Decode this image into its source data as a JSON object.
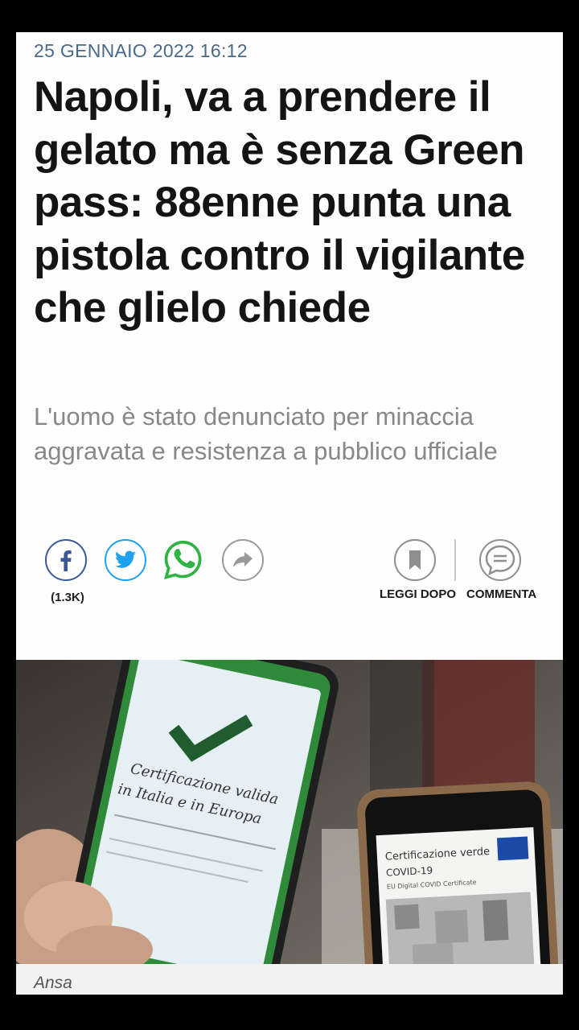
{
  "article": {
    "date": "25 GENNAIO 2022 16:12",
    "title": "Napoli, va a prendere il gelato ma è senza Green pass: 88enne punta una pistola contro il vigilante che glielo chiede",
    "subtitle": "L'uomo è stato denunciato per minaccia aggravata e resistenza a pubblico ufficiale"
  },
  "share": {
    "facebook_count": "(1.3K)",
    "icons": [
      "facebook-icon",
      "twitter-icon",
      "whatsapp-icon",
      "share-arrow-icon"
    ]
  },
  "actions": {
    "read_later_label": "LEGGI DOPO",
    "comment_label": "COMMENTA"
  },
  "photo": {
    "credit": "Ansa",
    "phone1_text_line1": "Certificazione valida",
    "phone1_text_line2": "in Italia e in Europa",
    "phone2_title_line1": "Certificazione verde",
    "phone2_title_line2": "COVID-19",
    "phone2_subtitle": "EU Digital COVID Certificate"
  },
  "colors": {
    "facebook": "#3b5998",
    "twitter": "#1da1f2",
    "whatsapp": "#2fb344",
    "date": "#4a6a8a"
  }
}
